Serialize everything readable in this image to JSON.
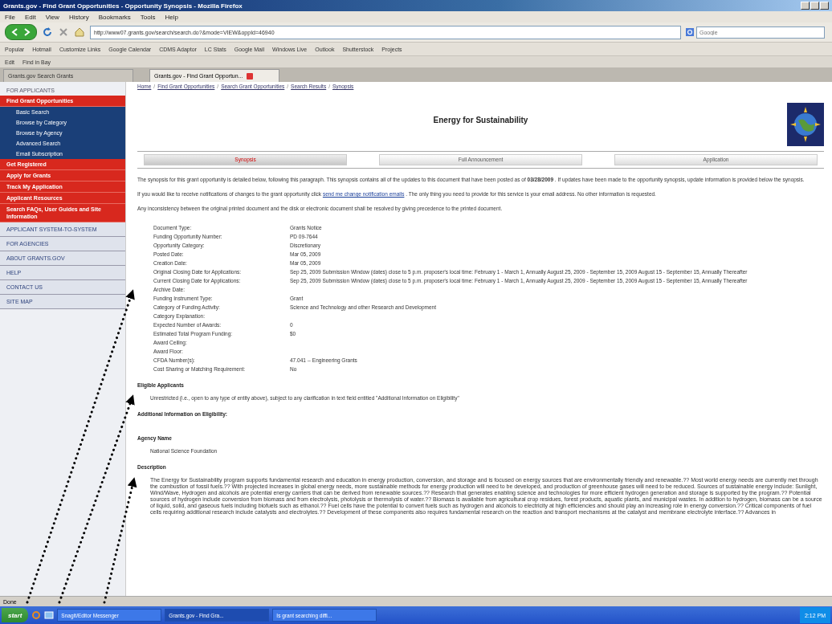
{
  "browser": {
    "title": "Grants.gov - Find Grant Opportunities - Opportunity Synopsis - Mozilla Firefox",
    "menu": [
      "File",
      "Edit",
      "View",
      "History",
      "Bookmarks",
      "Tools",
      "Help"
    ],
    "url": "http://www07.grants.gov/search/search.do?&mode=VIEW&oppId=46940",
    "search_placeholder": "Google",
    "bookmarks": [
      "Popular",
      "Hotmail",
      "Customize Links",
      "Google Calendar",
      "CDMS Adaptor",
      "LC Stats",
      "Google Mail",
      "Windows Live",
      "Outlook",
      "Shutterstock",
      "Projects"
    ],
    "toolbar": [
      "Edit",
      "Find in Bay"
    ],
    "tabs": [
      {
        "label": "Grants.gov Search Grants",
        "selected": false
      },
      {
        "label": "Grants.gov - Find Grant Opportun...",
        "selected": true
      }
    ],
    "status": "Done"
  },
  "sidebar": {
    "header": "FOR APPLICANTS",
    "items": [
      {
        "kind": "primary",
        "label": "Find Grant Opportunities"
      },
      {
        "kind": "sub",
        "label": "Basic Search"
      },
      {
        "kind": "sub",
        "label": "Browse by Category"
      },
      {
        "kind": "sub",
        "label": "Browse by Agency"
      },
      {
        "kind": "sub",
        "label": "Advanced Search"
      },
      {
        "kind": "sub",
        "label": "Email Subscription"
      },
      {
        "kind": "primary",
        "label": "Get Registered"
      },
      {
        "kind": "primary",
        "label": "Apply for Grants"
      },
      {
        "kind": "primary",
        "label": "Track My Application"
      },
      {
        "kind": "primary",
        "label": "Applicant Resources"
      },
      {
        "kind": "primary",
        "label": "Search FAQs, User Guides and Site Information"
      },
      {
        "kind": "plain",
        "label": "APPLICANT SYSTEM-TO-SYSTEM"
      },
      {
        "kind": "plain",
        "label": "FOR AGENCIES"
      },
      {
        "kind": "plain",
        "label": "ABOUT GRANTS.GOV"
      },
      {
        "kind": "plain",
        "label": "HELP"
      },
      {
        "kind": "plain",
        "label": "CONTACT US"
      },
      {
        "kind": "plain",
        "label": "SITE MAP"
      }
    ]
  },
  "page": {
    "breadcrumb": [
      "Home",
      "Find Grant Opportunities",
      "Search Grant Opportunities",
      "Search Results",
      "Synopsis"
    ],
    "separator": "/",
    "title": "Energy for Sustainability",
    "tabs": [
      {
        "label": "Synopsis",
        "selected": true
      },
      {
        "label": "Full Announcement",
        "selected": false
      },
      {
        "label": "Application",
        "selected": false
      }
    ],
    "intro": "The synopsis for this grant opportunity is detailed below, following this paragraph. This synopsis contains all of the updates to this document that have been posted as of **03/28/2009** . If updates have been made to the opportunity synopsis, update information is provided below the synopsis.",
    "notify_before": "If you would like to receive notifications of changes to the grant opportunity click",
    "notify_link": "send me change notification emails",
    "notify_after": ". The only thing you need to provide for this service is your email address. No other information is requested.",
    "disclaimer": "Any inconsistency between the original printed document and the disk or electronic document shall be resolved by giving precedence to the printed document.",
    "details": [
      {
        "label": "Document Type:",
        "value": "Grants Notice"
      },
      {
        "label": "Funding Opportunity Number:",
        "value": "PD 09-7644"
      },
      {
        "label": "Opportunity Category:",
        "value": "Discretionary"
      },
      {
        "label": "Posted Date:",
        "value": "Mar 05, 2009"
      },
      {
        "label": "Creation Date:",
        "value": "Mar 05, 2009"
      },
      {
        "label": "Original Closing Date for Applications:",
        "value": "Sep 25, 2009   Submission Window (dates) close to 5 p.m. proposer's local time: February 1 - March 1, Annually August 25, 2009 - September 15, 2009 August 15 - September 15, Annually Thereafter"
      },
      {
        "label": "Current Closing Date for Applications:",
        "value": "Sep 25, 2009   Submission Window (dates) close to 5 p.m. proposer's local time: February 1 - March 1, Annually August 25, 2009 - September 15, 2009 August 15 - September 15, Annually Thereafter"
      },
      {
        "label": "Archive Date:"
      },
      {
        "label": "Funding Instrument Type:",
        "value": "Grant"
      },
      {
        "label": "Category of Funding Activity:",
        "value": "Science and Technology and other Research and Development"
      },
      {
        "label": "Category Explanation:"
      },
      {
        "label": "Expected Number of Awards:",
        "value": "0"
      },
      {
        "label": "Estimated Total Program Funding:",
        "value": "$0"
      },
      {
        "label": "Award Ceiling:"
      },
      {
        "label": "Award Floor:"
      },
      {
        "label": "CFDA Number(s):",
        "value": "47.041  --  Engineering Grants"
      },
      {
        "label": "Cost Sharing or Matching Requirement:",
        "value": "No"
      }
    ],
    "sections": [
      {
        "heading": "Eligible Applicants",
        "text": "Unrestricted (i.e., open to any type of entity above), subject to any clarification in text field entitled \"Additional Information on Eligibility\""
      },
      {
        "heading": "Additional Information on Eligibility:"
      },
      {
        "heading": "Agency Name",
        "text": "National Science Foundation"
      },
      {
        "heading": "Description",
        "text": "The Energy for Sustainability program supports fundamental research and education in energy production, conversion, and storage and is focused on energy sources that are environmentally friendly and renewable.?? Most world energy needs are currently met through the combustion of fossil fuels.?? With projected increases in global energy needs, more sustainable methods for energy production will need to be developed, and production of greenhouse gases will need to be reduced. Sources of sustainable energy include: Sunlight, Wind/Wave, Hydrogen and alcohols are potential energy carriers that can be derived from renewable sources.?? Research that generates enabling science and technologies for more efficient hydrogen generation and storage is supported by the program.?? Potential sources of hydrogen include conversion from biomass and from electrolysis, photolysis or thermolysis of water.?? Biomass is available from agricultural crop residues, forest products, aquatic plants, and municipal wastes. In addition to hydrogen, biomass can be a source of liquid, solid, and gaseous fuels including biofuels such as ethanol.?? Fuel cells have the potential to convert fuels such as hydrogen and alcohols to electricity at high efficiencies and should play an increasing role in energy conversion.?? Critical components of fuel cells requiring additional research include catalysts and electrolytes.?? Development of these components also requires fundamental research on the reaction and transport mechanisms at the catalyst and membrane electrolyte interface.?? Advances in"
      }
    ]
  },
  "taskbar": {
    "start": "start",
    "tasks": [
      {
        "label": "SnagIt/Editor Messenger",
        "selected": false
      },
      {
        "label": "Grants.gov - Find Gra...",
        "selected": true
      },
      {
        "label": "Is grant searching diffi...",
        "selected": false
      }
    ],
    "clock": "2:12 PM"
  }
}
